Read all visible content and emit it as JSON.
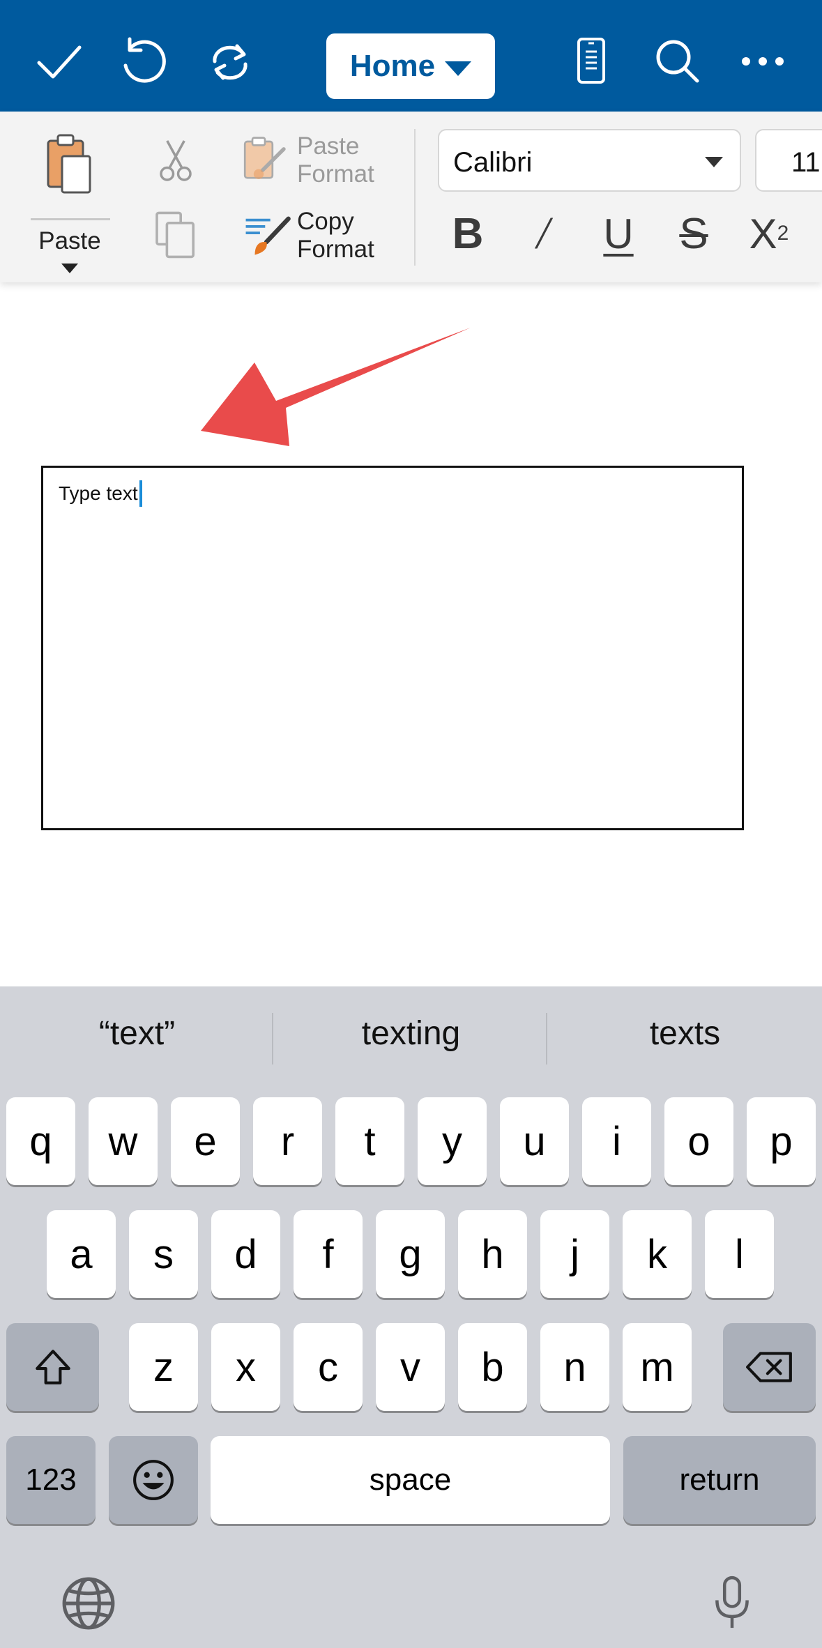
{
  "toolbar": {
    "tab_label": "Home"
  },
  "ribbon": {
    "paste_label": "Paste",
    "paste_format_line1": "Paste",
    "paste_format_line2": "Format",
    "copy_format_line1": "Copy",
    "copy_format_line2": "Format",
    "font_name": "Calibri",
    "font_size": "11",
    "bold_label": "B",
    "italic_label": "/",
    "underline_label": "U",
    "strike_label": "S",
    "subscript_label": "X",
    "subscript_sub": "2"
  },
  "document": {
    "textbox_text": "Type text",
    "arrow_color": "#e94b4b"
  },
  "keyboard": {
    "suggestions": [
      "“text”",
      "texting",
      "texts"
    ],
    "row1": [
      "q",
      "w",
      "e",
      "r",
      "t",
      "y",
      "u",
      "i",
      "o",
      "p"
    ],
    "row2": [
      "a",
      "s",
      "d",
      "f",
      "g",
      "h",
      "j",
      "k",
      "l"
    ],
    "row3": [
      "z",
      "x",
      "c",
      "v",
      "b",
      "n",
      "m"
    ],
    "numbers_label": "123",
    "space_label": "space",
    "return_label": "return"
  },
  "colors": {
    "topbar": "#005a9e",
    "ribbon": "#f3f3f3",
    "keyboard_bg": "#d1d3d9",
    "caret": "#1a8cd8"
  },
  "icons": {
    "topbar": [
      "checkmark-icon",
      "undo-icon",
      "redo-icon",
      "mobile-view-icon",
      "search-icon",
      "more-icon"
    ],
    "ribbon": [
      "paste-icon",
      "cut-icon",
      "copy-icon",
      "paste-format-icon",
      "copy-format-icon"
    ],
    "keyboard": [
      "shift-icon",
      "delete-icon",
      "emoji-icon",
      "globe-icon",
      "microphone-icon"
    ]
  }
}
